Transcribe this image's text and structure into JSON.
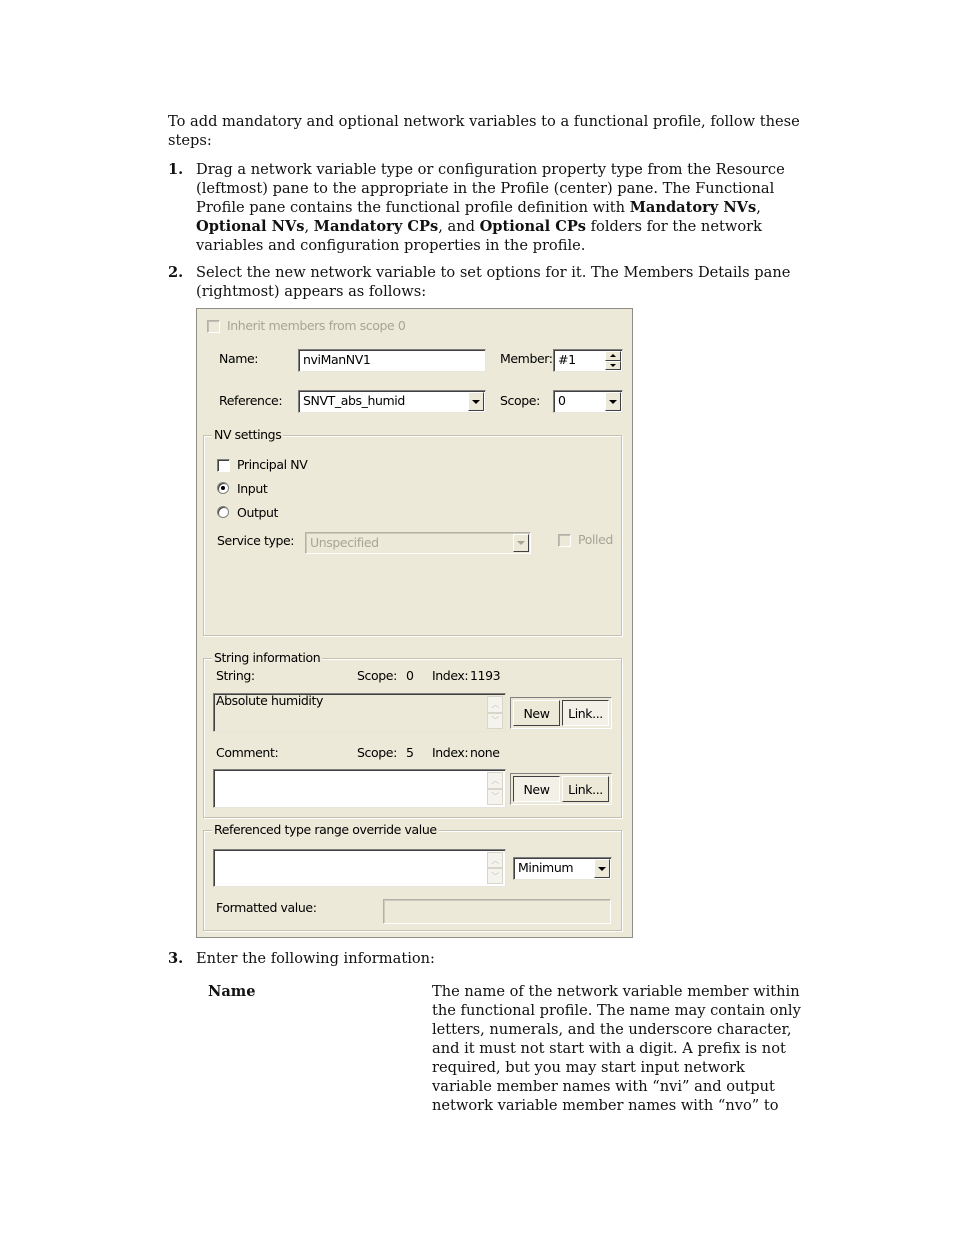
{
  "intro": "To add mandatory and optional network variables to a functional profile, follow these steps:",
  "steps": [
    {
      "num": "1.",
      "parts": [
        {
          "t": "Drag a network variable type or configuration property type from the Resource (leftmost) pane to the appropriate in the Profile (center) pane.  The Functional Profile pane contains the functional profile definition with "
        },
        {
          "b": "Mandatory NVs"
        },
        {
          "t": ", "
        },
        {
          "b": "Optional NVs"
        },
        {
          "t": ", "
        },
        {
          "b": "Mandatory CPs"
        },
        {
          "t": ", and "
        },
        {
          "b": "Optional CPs"
        },
        {
          "t": " folders for the network variables and configuration properties in the profile."
        }
      ]
    },
    {
      "num": "2.",
      "text": "Select the new network variable to set options for it. The Members Details pane (rightmost) appears as follows:"
    },
    {
      "num": "3.",
      "text": "Enter the following information:"
    }
  ],
  "dialog": {
    "inherit_label": "Inherit members from scope 0",
    "inherit_checked": false,
    "name_label": "Name:",
    "name_value": "nviManNV1",
    "member_label": "Member:",
    "member_value": "#1",
    "reference_label": "Reference:",
    "reference_value": "SNVT_abs_humid",
    "scope_label": "Scope:",
    "scope_value": "0",
    "nv_settings": {
      "legend": "NV settings",
      "principal_label": "Principal NV",
      "principal_checked": false,
      "input_label": "Input",
      "output_label": "Output",
      "direction_selected": "Input",
      "service_type_label": "Service type:",
      "service_type_value": "Unspecified",
      "polled_label": "Polled",
      "polled_checked": false
    },
    "string_info": {
      "legend": "String information",
      "string_label": "String:",
      "string_scope_label": "Scope:",
      "string_scope_value": "0",
      "string_index_label": "Index:",
      "string_index_value": "1193",
      "string_value": "Absolute humidity",
      "new_label": "New",
      "link_label": "Link...",
      "comment_label": "Comment:",
      "comment_scope_label": "Scope:",
      "comment_scope_value": "5",
      "comment_index_label": "Index:",
      "comment_index_value": "none",
      "comment_value": "",
      "new2_label": "New",
      "link2_label": "Link..."
    },
    "range_override": {
      "legend": "Referenced type range override value",
      "value": "",
      "mode_value": "Minimum",
      "formatted_label": "Formatted value:",
      "formatted_value": ""
    }
  },
  "definition": {
    "term": "Name",
    "description": "The name of the network variable member within the functional profile.  The name may contain only letters, numerals, and the underscore character, and it must not start with a digit.  A prefix is not required, but you may start input network variable member names with “nvi” and output network variable member names with “nvo” to"
  }
}
